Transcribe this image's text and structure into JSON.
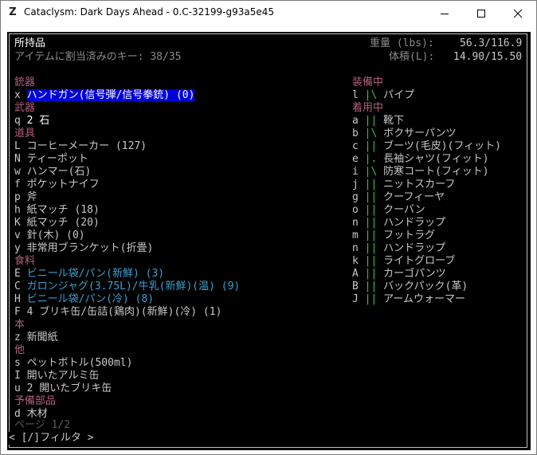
{
  "window": {
    "title": "Cataclysm: Dark Days Ahead - 0.C-32199-g93a5e45",
    "app_icon": "Z"
  },
  "header": {
    "title": "所持品",
    "keys_assigned": "アイテムに割当済みのキー: 38/35",
    "weight_label": "重量 (lbs):",
    "weight_value": "56.3/116.9",
    "volume_label": "体積(L):",
    "volume_value": "14.90/15.50"
  },
  "inventory": [
    {
      "category": "銃器",
      "items": [
        {
          "key": "x",
          "name": "ハンドガン(信号弾/信号拳銃) (0)",
          "style": "sel"
        }
      ]
    },
    {
      "category": "武器",
      "items": [
        {
          "key": "q",
          "name": "2 石",
          "style": "w"
        }
      ]
    },
    {
      "category": "道具",
      "items": [
        {
          "key": "L",
          "name": "コーヒーメーカー (127)",
          "style": "lg"
        },
        {
          "key": "N",
          "name": "ティーポット",
          "style": "lg"
        },
        {
          "key": "w",
          "name": "ハンマー(石)",
          "style": "lg"
        },
        {
          "key": "f",
          "name": "ポケットナイフ",
          "style": "lg"
        },
        {
          "key": "p",
          "name": "斧",
          "style": "lg"
        },
        {
          "key": "h",
          "name": "紙マッチ (18)",
          "style": "lg"
        },
        {
          "key": "K",
          "name": "紙マッチ (20)",
          "style": "lg"
        },
        {
          "key": "v",
          "name": "針(木) (0)",
          "style": "lg"
        },
        {
          "key": "y",
          "name": "非常用ブランケット(折畳)",
          "style": "lg"
        }
      ]
    },
    {
      "category": "食料",
      "items": [
        {
          "key": "E",
          "name": "ビニール袋/パン(新鮮) (3)",
          "style": "c"
        },
        {
          "key": "C",
          "name": "ガロンジャグ(3.75L)/牛乳(新鮮)(温) (9)",
          "style": "c"
        },
        {
          "key": "H",
          "name": "ビニール袋/パン(冷) (8)",
          "style": "c"
        },
        {
          "key": "F",
          "name": "4 ブリキ缶/缶詰(鶏肉)(新鮮)(冷) (1)",
          "style": "lg"
        }
      ]
    },
    {
      "category": "本",
      "items": [
        {
          "key": "z",
          "name": "新聞紙",
          "style": "lg"
        }
      ]
    },
    {
      "category": "他",
      "items": [
        {
          "key": "s",
          "name": "ペットボトル(500ml)",
          "style": "lg"
        },
        {
          "key": "I",
          "name": "開いたアルミ缶",
          "style": "lg"
        },
        {
          "key": "u",
          "name": "2 開いたブリキ缶",
          "style": "lg"
        }
      ]
    },
    {
      "category": "予備部品",
      "items": [
        {
          "key": "d",
          "name": "木材",
          "style": "lg"
        }
      ]
    }
  ],
  "wielded": {
    "category": "装備中",
    "items": [
      {
        "key": "l",
        "mark": "|\\",
        "name": "パイプ"
      }
    ]
  },
  "worn": {
    "category": "着用中",
    "items": [
      {
        "key": "a",
        "mark": "||",
        "name": "靴下"
      },
      {
        "key": "b",
        "mark": "|\\",
        "name": "ボクサーパンツ"
      },
      {
        "key": "c",
        "mark": "||",
        "name": "ブーツ(毛皮)(フィット)"
      },
      {
        "key": "e",
        "mark": "|.",
        "name": "長袖シャツ(フィット)"
      },
      {
        "key": "i",
        "mark": "|\\",
        "name": "防寒コート(フィット)"
      },
      {
        "key": "j",
        "mark": "||",
        "name": "ニットスカーフ"
      },
      {
        "key": "g",
        "mark": "||",
        "name": "クーフィーヤ"
      },
      {
        "key": "o",
        "mark": "||",
        "name": "クーバン"
      },
      {
        "key": "n",
        "mark": "||",
        "name": "ハンドラップ"
      },
      {
        "key": "m",
        "mark": "||",
        "name": "フットラグ"
      },
      {
        "key": "n",
        "mark": "||",
        "name": "ハンドラップ"
      },
      {
        "key": "k",
        "mark": "||",
        "name": "ライトグローブ"
      },
      {
        "key": "A",
        "mark": "||",
        "name": "カーゴパンツ"
      },
      {
        "key": "B",
        "mark": "||",
        "name": "バックパック(革)"
      },
      {
        "key": "J",
        "mark": "||",
        "name": "アームウォーマー"
      }
    ]
  },
  "footer": {
    "page": "ページ 1/2",
    "filter": "< [/]フィルタ >"
  },
  "colors": {
    "terminal_bg": "#000000",
    "category": "#b0607c",
    "selected_bg": "#0000d8",
    "food": "#3aa0d0",
    "mark_green": "#35c835"
  }
}
